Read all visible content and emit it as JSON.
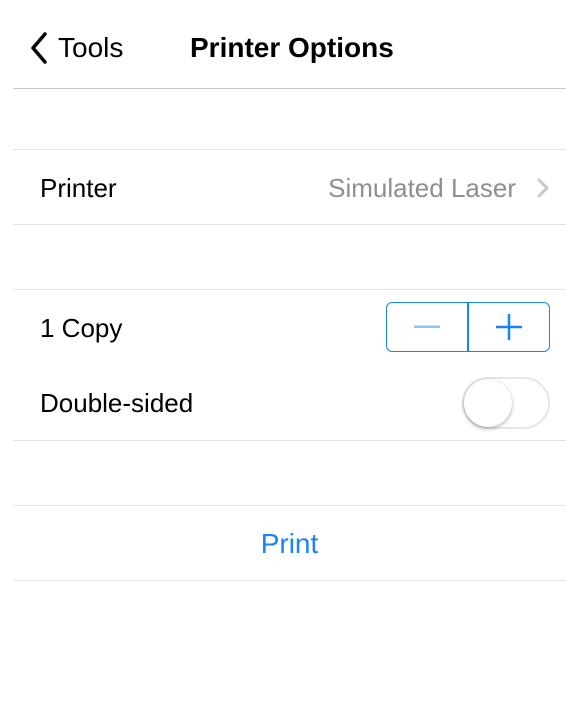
{
  "navbar": {
    "back_label": "Tools",
    "title": "Printer Options"
  },
  "printer_row": {
    "label": "Printer",
    "value": "Simulated Laser"
  },
  "copies_row": {
    "label": "1 Copy",
    "count": 1
  },
  "double_sided_row": {
    "label": "Double-sided",
    "enabled": false
  },
  "print_row": {
    "label": "Print"
  },
  "colors": {
    "accent": "#1a82fb",
    "secondary_text": "#8e8e93",
    "separator": "#e3e3e6"
  },
  "icons": [
    "chevron-left-icon",
    "chevron-right-icon",
    "minus-icon",
    "plus-icon"
  ]
}
